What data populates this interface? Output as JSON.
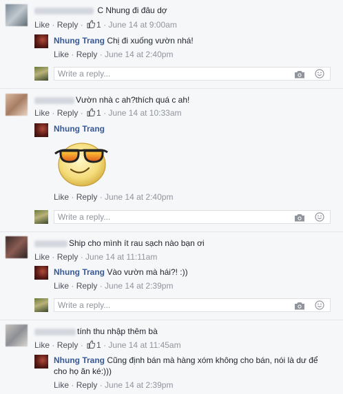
{
  "comments": [
    {
      "text": "C Nhung đi đâu dợ",
      "meta": {
        "like": "Like",
        "reply": "Reply",
        "likes": "1",
        "time": "June 14 at 9:00am"
      },
      "reply": {
        "author": "Nhung Trang",
        "text": "Chị đi xuống vườn nhá!",
        "like": "Like",
        "reply_label": "Reply",
        "time": "June 14 at 2:40pm"
      },
      "input_placeholder": "Write a reply..."
    },
    {
      "text": "Vườn nhà c ah?thích quá c ah!",
      "meta": {
        "like": "Like",
        "reply": "Reply",
        "likes": "1",
        "time": "June 14 at 10:33am"
      },
      "reply": {
        "author": "Nhung Trang",
        "sticker": "sunglasses-smiley-sticker",
        "like": "Like",
        "reply_label": "Reply",
        "time": "June 14 at 2:40pm"
      },
      "input_placeholder": "Write a reply..."
    },
    {
      "text": "Ship cho mình ít rau sạch nào bạn ơi",
      "meta": {
        "like": "Like",
        "reply": "Reply",
        "time": "June 14 at 11:11am"
      },
      "reply": {
        "author": "Nhung Trang",
        "text": "Vào vườn mà hái?! :))",
        "like": "Like",
        "reply_label": "Reply",
        "time": "June 14 at 2:39pm"
      },
      "input_placeholder": "Write a reply..."
    },
    {
      "text": "tính thu nhập thêm bà",
      "meta": {
        "like": "Like",
        "reply": "Reply",
        "likes": "1",
        "time": "June 14 at 11:45am"
      },
      "reply": {
        "author": "Nhung Trang",
        "text_line1": "Cũng định bán mà hàng xóm không cho bán, nói là dư để",
        "text_line2": "cho họ ăn ké:)))",
        "like": "Like",
        "reply_label": "Reply",
        "time": "June 14 at 2:39pm"
      }
    }
  ],
  "colors": {
    "link": "#365899",
    "meta": "#90949c",
    "background": "#f6f7f9"
  },
  "icons": [
    "thumbs-up-icon",
    "camera-icon",
    "smiley-icon"
  ]
}
